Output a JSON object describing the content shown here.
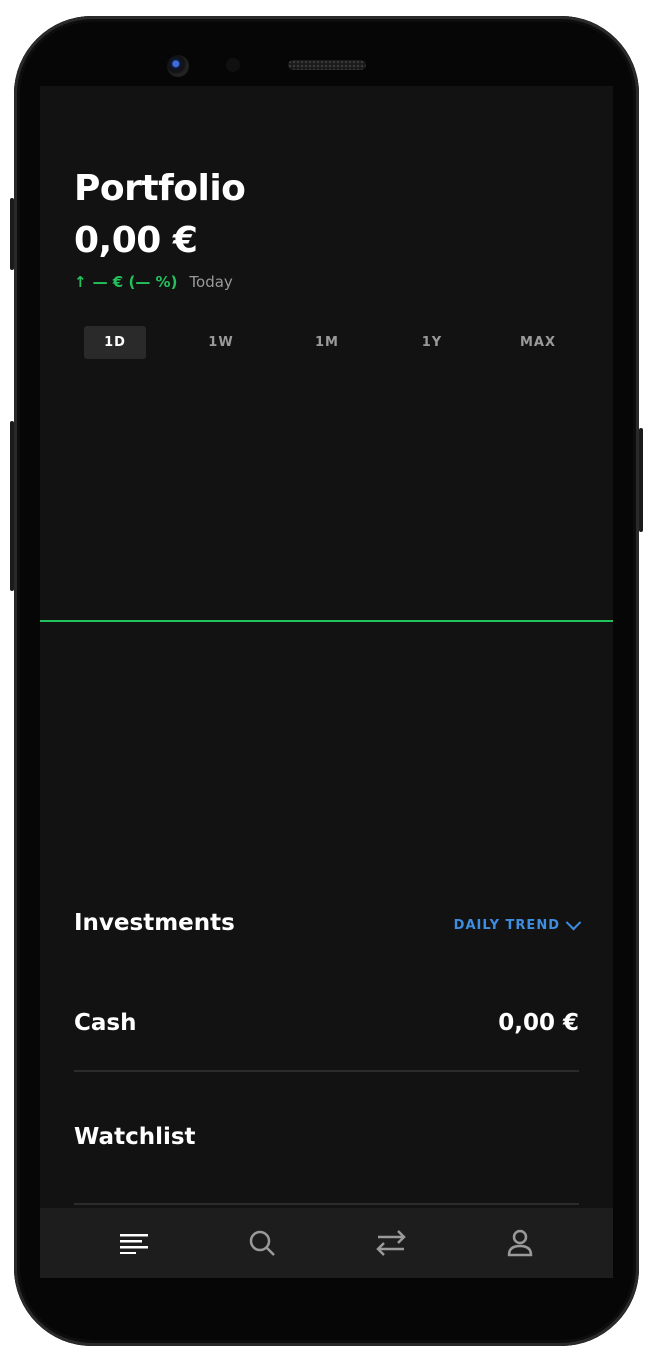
{
  "header": {
    "title": "Portfolio",
    "value": "0,00 €",
    "change_arrow": "↑",
    "change": "— € (— %)",
    "period": "Today"
  },
  "ranges": [
    "1D",
    "1W",
    "1M",
    "1Y",
    "MAX"
  ],
  "active_range": "1D",
  "investments": {
    "title": "Investments",
    "trend_label": "DAILY TREND"
  },
  "cash": {
    "label": "Cash",
    "value": "0,00 €"
  },
  "watchlist": {
    "title": "Watchlist"
  },
  "nav": [
    {
      "icon": "portfolio-icon"
    },
    {
      "icon": "search-icon"
    },
    {
      "icon": "transfer-icon"
    },
    {
      "icon": "profile-icon"
    }
  ],
  "colors": {
    "background": "#121212",
    "positive": "#23c15c",
    "accent": "#3d8de0"
  }
}
